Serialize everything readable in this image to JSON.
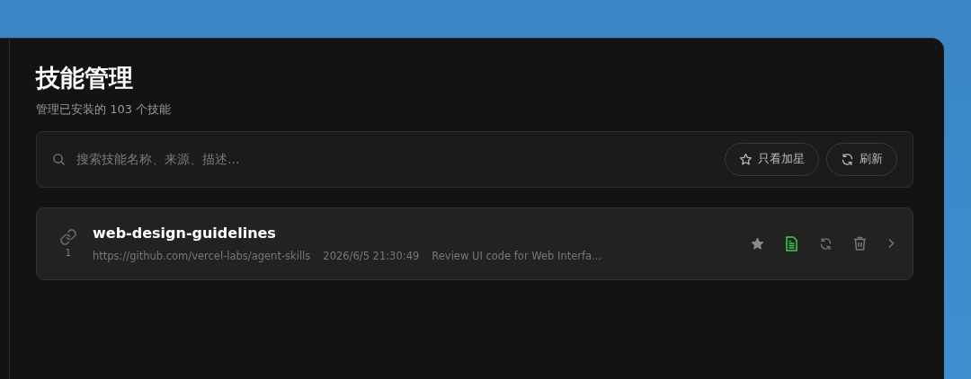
{
  "page": {
    "title": "技能管理",
    "subtitle": "管理已安装的 103 个技能"
  },
  "search": {
    "placeholder": "搜索技能名称、来源、描述..."
  },
  "toolbar_buttons": [
    {
      "kind": "star",
      "label": "只看加星",
      "selected": false
    },
    {
      "kind": "refresh",
      "label": "刷新",
      "selected": false
    }
  ],
  "skills": [
    {
      "index": "1",
      "name": "web-design-guidelines",
      "source": "https://github.com/vercel-labs/agent-skills",
      "time": "2026/6/5 21:30:49",
      "description": "Review UI code for Web Interfa...",
      "starred": true
    }
  ]
}
